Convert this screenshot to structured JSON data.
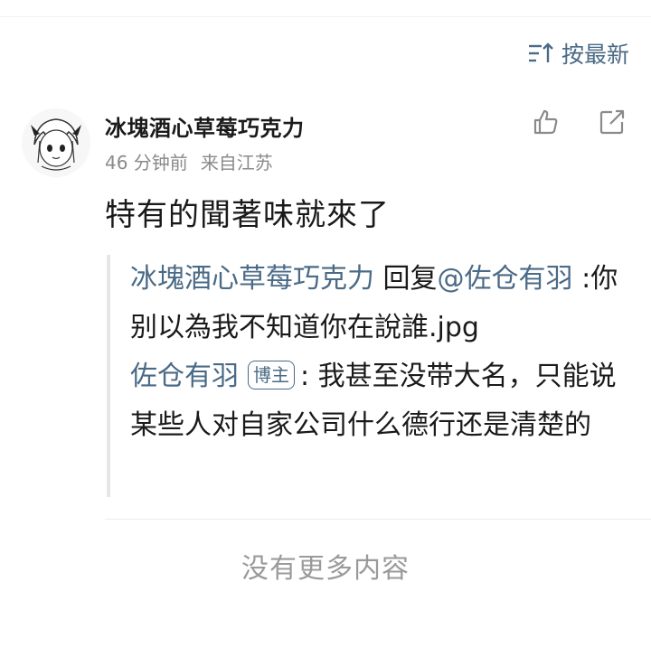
{
  "header": {
    "sort_label": "按最新",
    "sort_icon": "sort-lines-icon"
  },
  "comment": {
    "username": "冰塊酒心草莓巧克力",
    "time": "46 分钟前",
    "location": "来自江苏",
    "text": "特有的聞著味就來了",
    "actions": {
      "like_icon": "thumb-up-icon",
      "share_icon": "share-icon"
    },
    "quote": {
      "user1": "冰塊酒心草莓巧克力",
      "reply_word": "回复",
      "mention": "@佐仓有羽",
      "reply_text": ":你别以為我不知道你在說誰.jpg",
      "user2": "佐仓有羽",
      "badge": "博主",
      "reply2_text": ": 我甚至没带大名，只能说某些人对自家公司什么德行还是清楚的"
    }
  },
  "footer": {
    "no_more": "没有更多内容"
  },
  "colors": {
    "link": "#4a6a86",
    "meta": "#8a8a8a",
    "text": "#1a1a1a"
  }
}
